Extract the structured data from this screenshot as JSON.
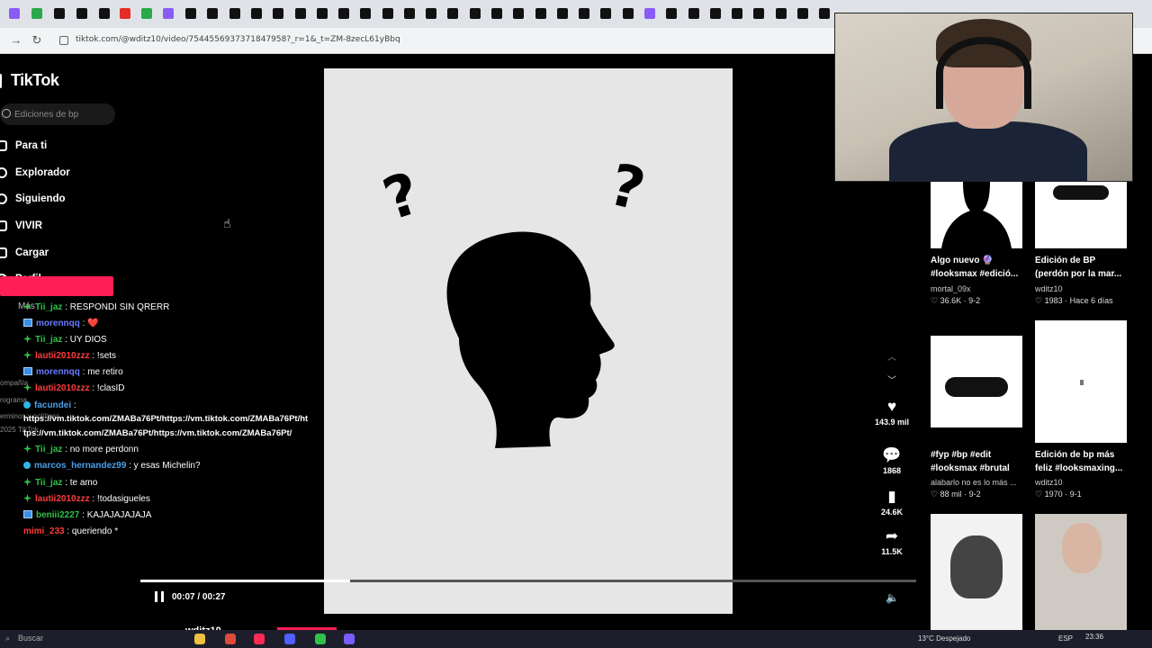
{
  "browser": {
    "url": "tiktok.com/@wditz10/video/7544556937371847958?_r=1&_t=ZM-8zecL61yBbq"
  },
  "sidebar": {
    "logo": "TikTok",
    "search_placeholder": "Ediciones de bp",
    "items": [
      {
        "label": "Para ti",
        "icon": "home-icon"
      },
      {
        "label": "Explorador",
        "icon": "compass-icon"
      },
      {
        "label": "Siguiendo",
        "icon": "following-icon"
      },
      {
        "label": "VIVIR",
        "icon": "live-icon"
      },
      {
        "label": "Cargar",
        "icon": "upload-icon"
      },
      {
        "label": "Perfil",
        "icon": "profile-icon"
      }
    ],
    "more_label": "Más",
    "faded": [
      "ompañía",
      "rograma",
      "erminos y políticas",
      "2025 TikTok"
    ]
  },
  "chat": [
    {
      "user": "Tii_jaz",
      "msg": ": RESPONDI SIN QRERR",
      "color": "#2fc24a",
      "badge": "g"
    },
    {
      "user": "morennqq",
      "msg": ": ❤️",
      "color": "#6a7bff",
      "badge": "b"
    },
    {
      "user": "Tii_jaz",
      "msg": ": UY DIOS",
      "color": "#2fc24a",
      "badge": "g"
    },
    {
      "user": "lautii2010zzz",
      "msg": ": !sets",
      "color": "#ff3b3b",
      "badge": "g"
    },
    {
      "user": "morennqq",
      "msg": ": me retiro",
      "color": "#6a7bff",
      "badge": "b"
    },
    {
      "user": "lautii2010zzz",
      "msg": ": !clasID",
      "color": "#ff3b3b",
      "badge": "g"
    },
    {
      "user": "facundei",
      "msg": ":",
      "color": "#4a9fe8",
      "badge": "c"
    },
    {
      "user": "Tii_jaz",
      "msg": ": no more perdonn",
      "color": "#2fc24a",
      "badge": "g"
    },
    {
      "user": "marcos_hernandez99",
      "msg": ": y esas Michelin?",
      "color": "#4a9fe8",
      "badge": "c"
    },
    {
      "user": "Tii_jaz",
      "msg": ": te amo",
      "color": "#2fc24a",
      "badge": "g"
    },
    {
      "user": "lautii2010zzz",
      "msg": ": !todasigueles",
      "color": "#ff3b3b",
      "badge": "g"
    },
    {
      "user": "beniii2227",
      "msg": ": KAJAJAJAJAJA",
      "color": "#2fc24a",
      "badge": "b"
    },
    {
      "user": "mimi_233",
      "msg": ": queriendo *",
      "color": "#ff3b3b",
      "badge": ""
    }
  ],
  "chat_long": [
    "https://vm.tiktok.com/ZMABa76Pt/https://vm.tiktok.com/ZMABa76Pt/ht",
    "tps://vm.tiktok.com/ZMABa76Pt/https://vm.tiktok.com/ZMABa76Pt/"
  ],
  "video": {
    "time": "00:07 / 00:27",
    "progress": 0.27,
    "likes": "143.9 mil",
    "comments": "1868",
    "saves": "24.6K",
    "shares": "11.5K",
    "author": "wditz10"
  },
  "grid": [
    {
      "title": "Algo nuevo 🔮 #looksmax #edició...",
      "author": "mortal_09x",
      "meta": "♡ 36.6K · 9-2"
    },
    {
      "title": "Edición de BP (perdón por la mar...",
      "author": "wditz10",
      "meta": "♡ 1983 · Hace 6 días"
    },
    {
      "title": "#fyp #bp #edit #looksmax #brutal",
      "author": "alabarlo no es lo más ...",
      "meta": "♡ 88 mil · 9-2"
    },
    {
      "title": "Edición de bp más feliz #looksmaxing...",
      "author": "wditz10",
      "meta": "♡ 1970 · 9-1"
    }
  ],
  "taskbar": {
    "search": "Buscar",
    "weather": "13°C Despejado",
    "lang": "ESP",
    "clock": "23:36"
  }
}
